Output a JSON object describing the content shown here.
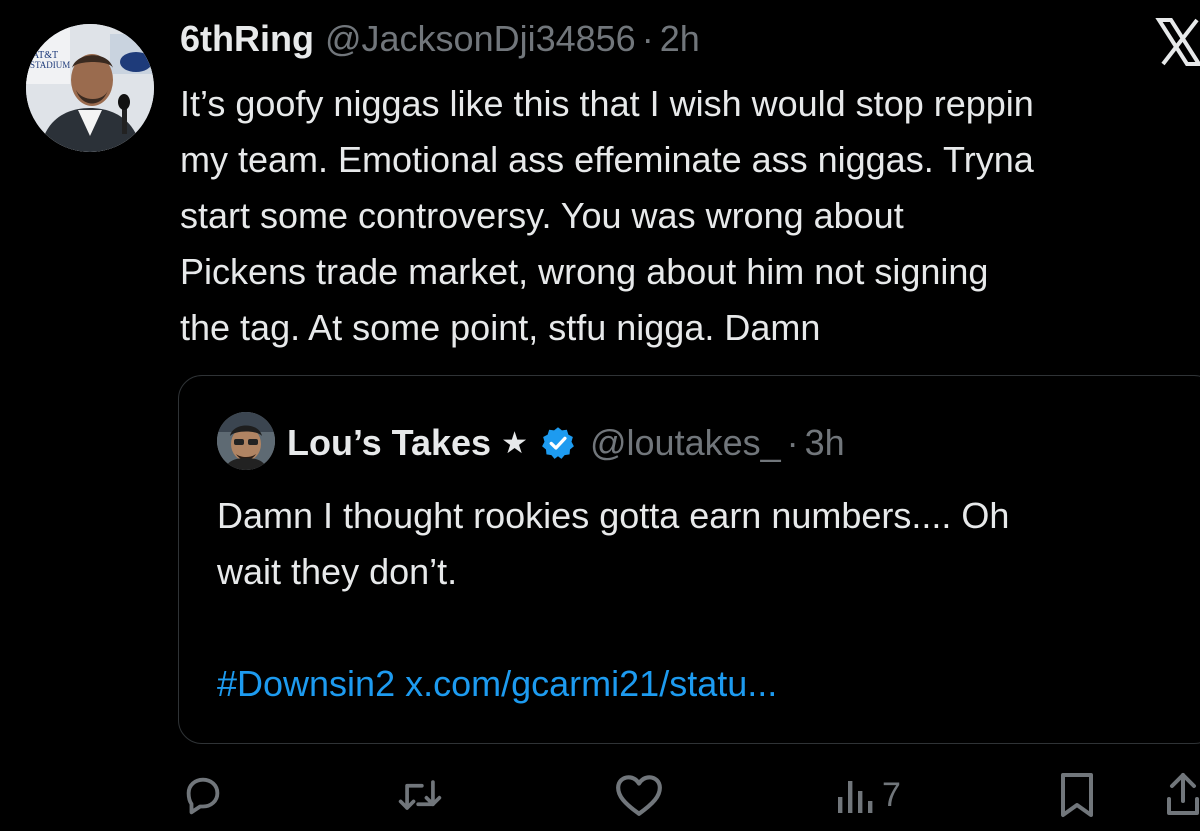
{
  "tweet": {
    "display_name": "6thRing",
    "handle": "@JacksonDji34856",
    "separator": "·",
    "time": "2h",
    "text_lines": [
      "It’s goofy niggas like this that I wish would stop reppin",
      "my team. Emotional ass effeminate ass niggas. Tryna",
      "start some controversy. You was wrong about",
      "Pickens trade market, wrong about him not signing",
      "the tag. At some point, stfu nigga. Damn"
    ]
  },
  "avatar_sign_text": "AT&T STADIUM",
  "quote": {
    "display_name": "Lou’s Takes",
    "star": "★",
    "handle": "@loutakes_",
    "separator": "·",
    "time": "3h",
    "text_lines": [
      "Damn I thought rookies gotta earn numbers.... Oh",
      "wait they don’t."
    ],
    "hashtag": "#Downsin2",
    "link": "x.com/gcarmi21/statu..."
  },
  "actions": {
    "reply_icon": "reply-icon",
    "retweet_icon": "retweet-icon",
    "like_icon": "heart-icon",
    "views_icon": "views-icon",
    "views_count": "7",
    "bookmark_icon": "bookmark-icon",
    "share_icon": "share-icon"
  },
  "colors": {
    "background": "#000000",
    "text": "#e7e9ea",
    "secondary": "#71767b",
    "link": "#1d9bf0",
    "border": "#2f3336",
    "verified": "#1d9bf0"
  }
}
